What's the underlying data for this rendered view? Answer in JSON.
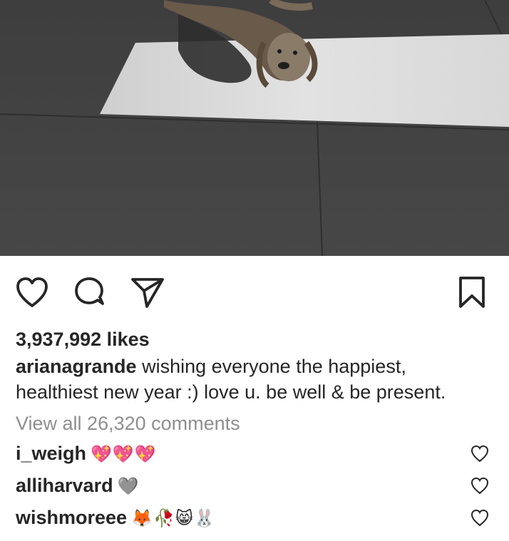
{
  "post": {
    "likes_text": "3,937,992 likes",
    "caption_user": "arianagrande",
    "caption_text": " wishing everyone the happiest, healthiest new year :) love u. be well & be present.",
    "view_all_text": "View all 26,320 comments"
  },
  "actions": {
    "like_icon": "heart-icon",
    "comment_icon": "comment-bubble-icon",
    "share_icon": "paper-plane-icon",
    "save_icon": "bookmark-icon"
  },
  "comments": [
    {
      "user": "i_weigh",
      "text": "💖💖💖"
    },
    {
      "user": "alliharvard",
      "text": "🩶"
    },
    {
      "user": "wishmoreee",
      "text": "🦊🥀😸🐰"
    }
  ],
  "colors": {
    "text": "#262626",
    "muted": "#8e8e8e"
  }
}
